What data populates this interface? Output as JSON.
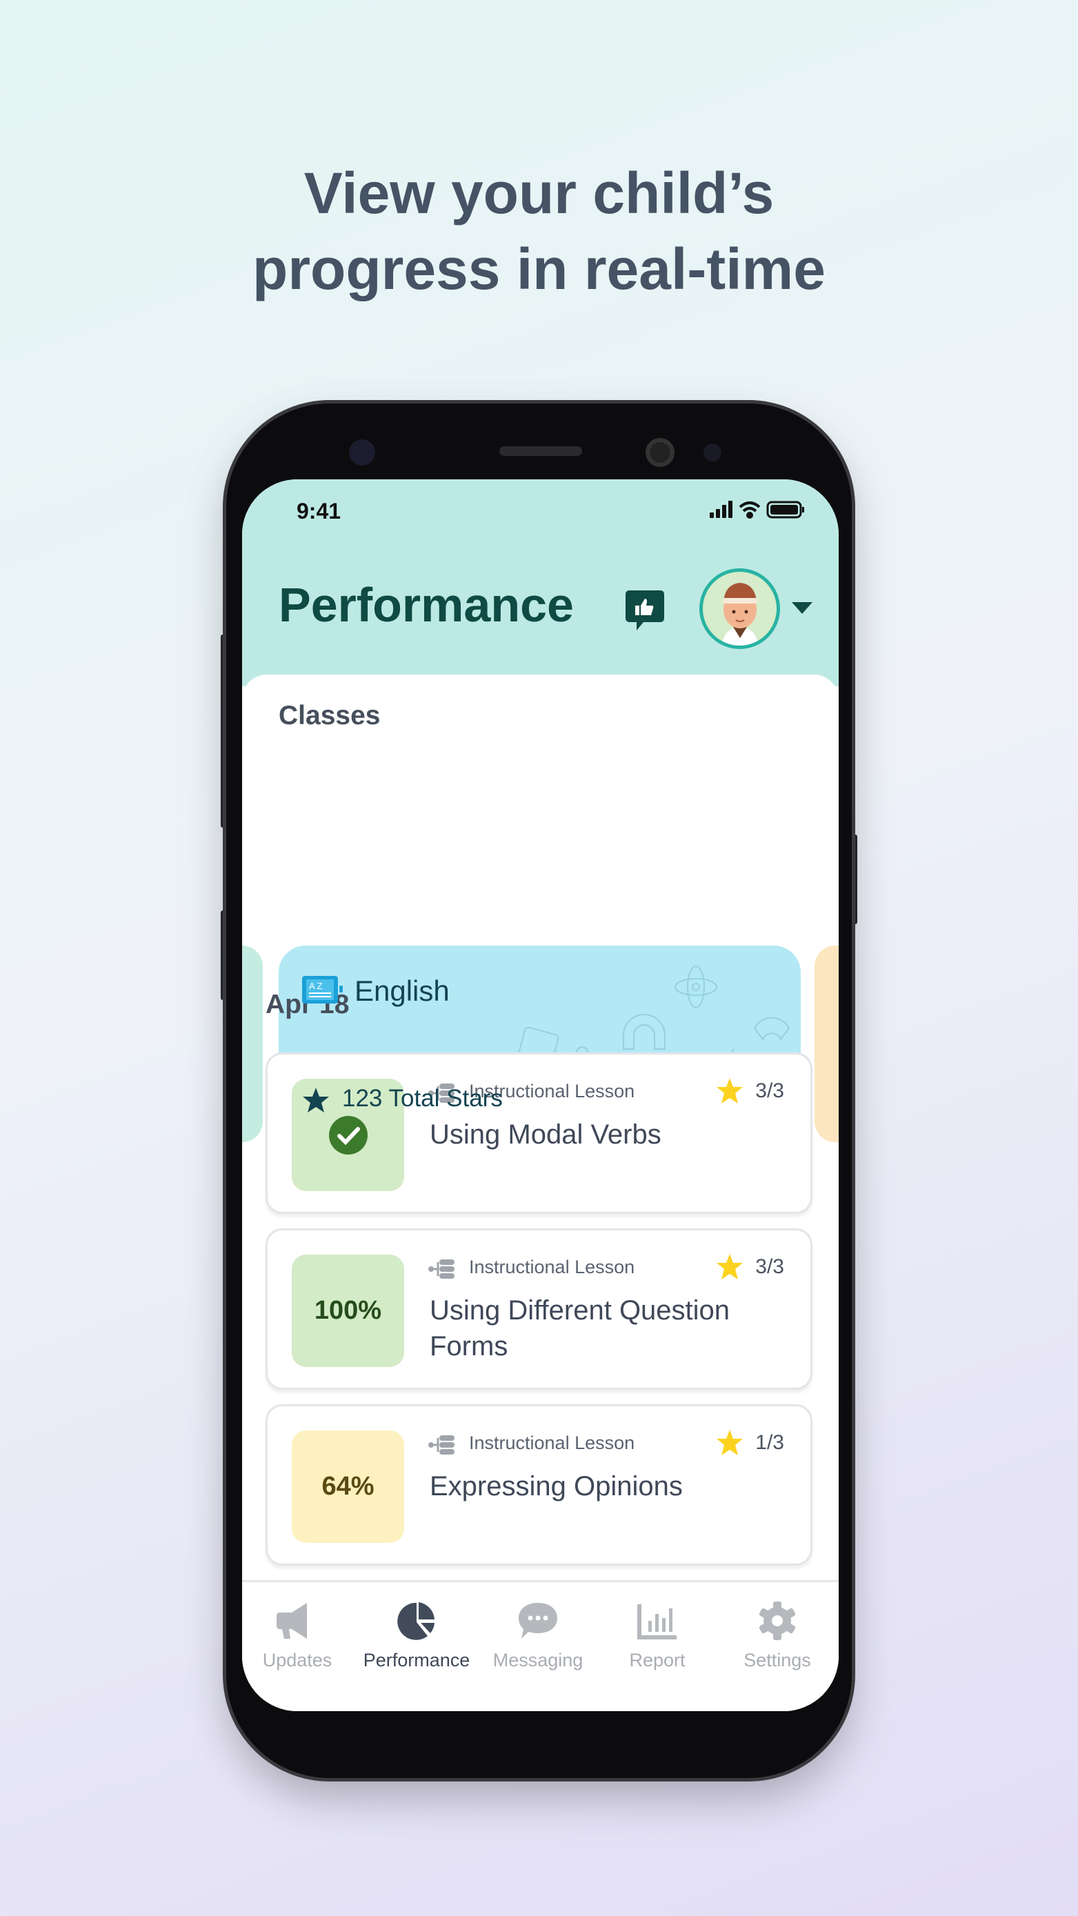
{
  "headline": {
    "line1": "View your child’s",
    "line2": "progress in real-time"
  },
  "status_bar": {
    "time": "9:41"
  },
  "header": {
    "title": "Performance"
  },
  "classes": {
    "heading": "Classes",
    "active_class": {
      "name": "English",
      "stars_label": "123 Total Stars",
      "color": "#b3e8f5"
    }
  },
  "date_heading": "Apr 18",
  "lessons": [
    {
      "type": "Instructional Lesson",
      "title": "Using Modal Verbs",
      "score": "3/3",
      "status": "complete",
      "badge": "",
      "badge_color": "#d3ebc6"
    },
    {
      "type": "Instructional Lesson",
      "title": "Using Different Question Forms",
      "score": "3/3",
      "status": "percent",
      "badge": "100%",
      "badge_color": "#d3ebc6"
    },
    {
      "type": "Instructional Lesson",
      "title": "Expressing Opinions",
      "score": "1/3",
      "status": "percent",
      "badge": "64%",
      "badge_color": "#fdf1bf"
    }
  ],
  "nav": [
    {
      "label": "Updates",
      "icon": "megaphone-icon"
    },
    {
      "label": "Performance",
      "icon": "pie-chart-icon",
      "active": true
    },
    {
      "label": "Messaging",
      "icon": "chat-bubble-icon"
    },
    {
      "label": "Report",
      "icon": "bar-chart-icon"
    },
    {
      "label": "Settings",
      "icon": "gear-icon"
    }
  ]
}
